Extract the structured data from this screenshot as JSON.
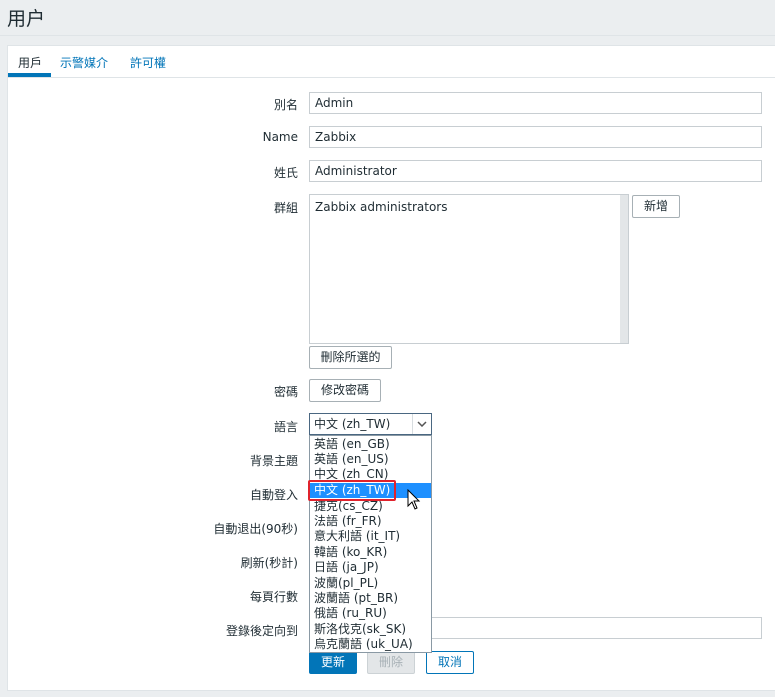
{
  "page": {
    "title": "用户"
  },
  "tabs": [
    {
      "label": "用戶",
      "active": true
    },
    {
      "label": "示警媒介",
      "active": false
    },
    {
      "label": "許可權",
      "active": false
    }
  ],
  "form": {
    "alias": {
      "label": "別名",
      "value": "Admin"
    },
    "name": {
      "label": "Name",
      "value": "Zabbix"
    },
    "surname": {
      "label": "姓氏",
      "value": "Administrator"
    },
    "groups": {
      "label": "群組",
      "items": [
        "Zabbix administrators"
      ],
      "add_button": "新增",
      "remove_button": "刪除所選的"
    },
    "password": {
      "label": "密碼",
      "button": "修改密碼"
    },
    "language": {
      "label": "語言",
      "selected": "中文 (zh_TW)",
      "options": [
        "英語 (en_GB)",
        "英語 (en_US)",
        "中文 (zh_CN)",
        "中文 (zh_TW)",
        "捷克(cs_CZ)",
        "法語 (fr_FR)",
        "意大利語 (it_IT)",
        "韓語 (ko_KR)",
        "日語 (ja_JP)",
        "波蘭(pl_PL)",
        "波蘭語 (pt_BR)",
        "俄語 (ru_RU)",
        "斯洛伐克(sk_SK)",
        "烏克蘭語 (uk_UA)"
      ]
    },
    "theme": {
      "label": "背景主題"
    },
    "autologin": {
      "label": "自動登入"
    },
    "autologout": {
      "label": "自動退出(90秒)"
    },
    "refresh": {
      "label": "刷新(秒計)"
    },
    "rows_per_page": {
      "label": "每頁行數"
    },
    "url_after_login": {
      "label": "登錄後定向到",
      "value": ""
    }
  },
  "actions": {
    "update": "更新",
    "delete": "刪除",
    "cancel": "取消"
  },
  "colors": {
    "accent": "#0275b8",
    "highlight": "#e0232d",
    "selected": "#1e90ff"
  }
}
